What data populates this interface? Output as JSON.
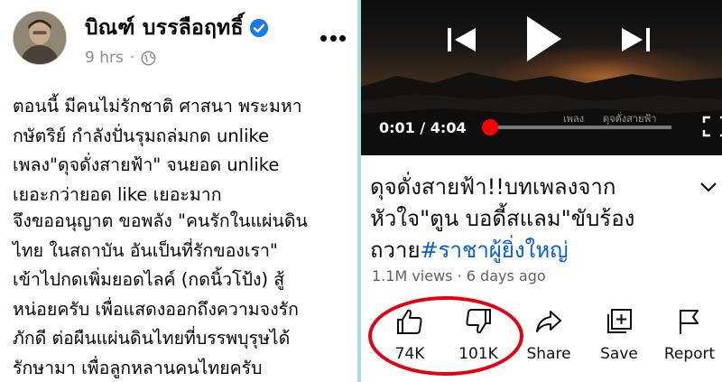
{
  "facebook_post": {
    "author_name": "บิณฑ์ บรรลือฤทธิ์",
    "verified_icon": "verified-badge-icon",
    "time": "9 hrs",
    "separator": "·",
    "privacy_icon": "globe-icon",
    "more_icon": "more-options-icon",
    "paragraph_1": "ตอนนี้ มีคนไม่รักชาติ ศาสนา พระมหา\nกษัตริย์ กำลังปั่นรุมถล่มกด unlike\nเพลง\"ดุจดั่งสายฟ้า\" จนยอด unlike\nเยอะกว่ายอด like เยอะมาก",
    "paragraph_2": "จึงขออนุญาต ขอพลัง \"คนรักในแผ่นดิน\nไทย ในสถาบัน อันเป็นที่รักของเรา\"\nเข้าไปกดเพิ่มยอดไลค์ (กดนิ้วโป้ง) สู้\nหน่อยครับ เพื่อแสดงออกถึงความจงรัก\nภักดี ต่อผืนแผ่นดินไทยที่บรรพบุรุษได้\nรักษามา เพื่อลูกหลานคนไทยครับ"
  },
  "youtube": {
    "player": {
      "current_time": "0:01 / 4:04",
      "progress_fraction": 0.004,
      "overlay_text_a": "เพลง",
      "overlay_text_b": "ดุจดั่งสายฟ้า",
      "icons": [
        "previous-icon",
        "play-icon",
        "next-icon",
        "fullscreen-icon"
      ]
    },
    "title_main": "ดุจดั่งสายฟ้า!!บทเพลงจาก\nหัวใจ\"ตูน บอดี้สแลม\"ขับร้อง\nถวาย",
    "title_hashtag": "#ราชาผู้ยิ่งใหญ่",
    "meta": "1.1M views · 6 days ago",
    "actions": {
      "like": "74K",
      "dislike": "101K",
      "share": "Share",
      "save": "Save",
      "report": "Report"
    },
    "colors": {
      "accent_red": "#ff0000",
      "hashtag_blue": "#065fd4",
      "highlight_red": "#e60012",
      "divider": "#aedcdc"
    }
  }
}
